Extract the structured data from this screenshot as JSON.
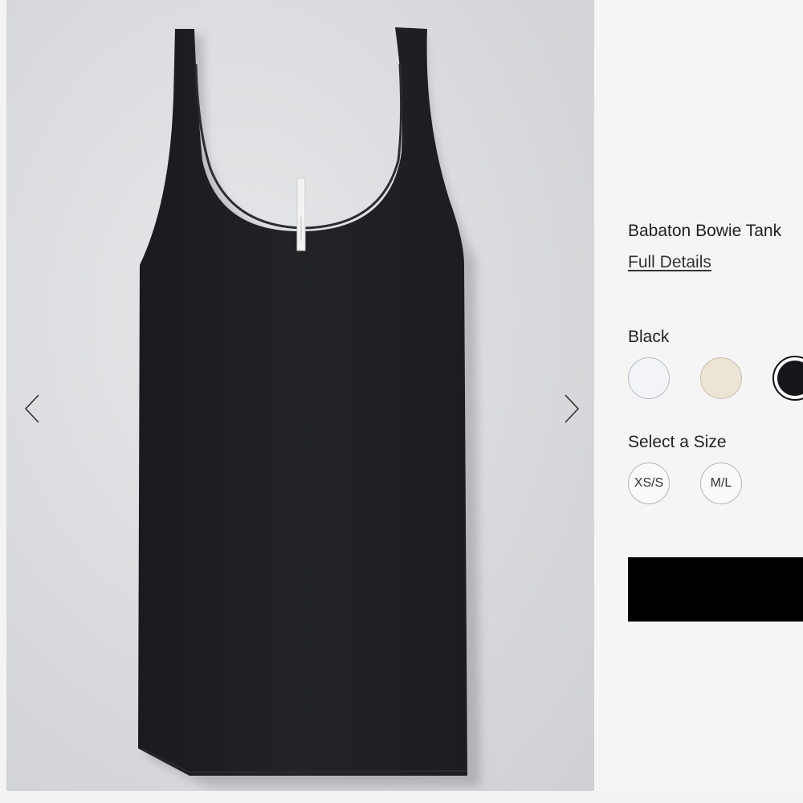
{
  "gallery": {
    "prev_icon": "chevron-left-icon",
    "next_icon": "chevron-right-icon",
    "tank_color": "#202124",
    "background_color": "#dcdde0"
  },
  "product": {
    "title": "Babaton Bowie Tank",
    "details_link": "Full Details"
  },
  "color": {
    "selected_label": "Black",
    "swatches": [
      {
        "name": "white",
        "hex": "#f3f4f8"
      },
      {
        "name": "cream",
        "hex": "#ece5d6"
      },
      {
        "name": "black",
        "hex": "#15151a",
        "selected": true
      }
    ]
  },
  "size": {
    "label": "Select a Size",
    "options": [
      "XS/S",
      "M/L"
    ]
  },
  "cart": {
    "button_color": "#000000"
  }
}
